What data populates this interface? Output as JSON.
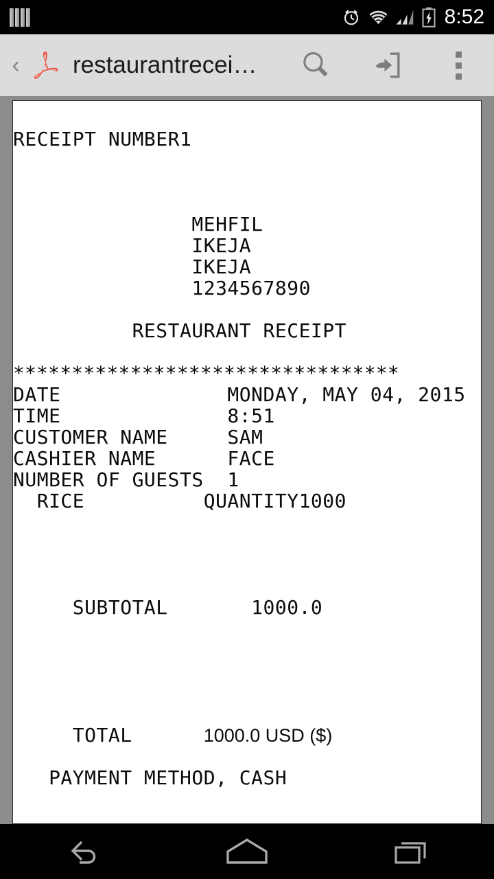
{
  "status_bar": {
    "time": "8:52",
    "icons": [
      "signal-bars-icon",
      "alarm-icon",
      "wifi-icon",
      "cell-signal-icon",
      "battery-charging-icon"
    ]
  },
  "app_bar": {
    "back_label": "‹",
    "app_logo": "adobe-acrobat-logo",
    "title": "restaurantrecei…",
    "search_icon": "search-icon",
    "open_with_icon": "open-with-icon",
    "overflow_icon": "overflow-menu-icon"
  },
  "receipt": {
    "receipt_number_line": "RECEIPT NUMBER1",
    "store_name": "MEHFIL",
    "store_city": "IKEJA",
    "store_area": "IKEJA",
    "store_phone": "1234567890",
    "doc_heading": "RESTAURANT RECEIPT",
    "divider": "*********************************",
    "fields": [
      {
        "label": "DATE",
        "value": "MONDAY, MAY 04, 2015"
      },
      {
        "label": "TIME",
        "value": "8:51"
      },
      {
        "label": "CUSTOMER NAME",
        "value": "SAM"
      },
      {
        "label": "CASHIER NAME",
        "value": "FACE"
      },
      {
        "label": "NUMBER OF GUESTS",
        "value": "1"
      }
    ],
    "line_item": {
      "name": "RICE",
      "quantity_label": "QUANTITY",
      "quantity": "1",
      "amount": "1000",
      "rendered": "  RICE          QUANTITY1000"
    },
    "subtotal_label": "SUBTOTAL",
    "subtotal_value": "1000.0",
    "total_label": "TOTAL",
    "total_value": "1000.0 USD ($)",
    "payment_line": "PAYMENT METHOD, CASH",
    "lines": {
      "l1": "RECEIPT NUMBER1",
      "l2": "               MEHFIL",
      "l3": "               IKEJA",
      "l4": "               IKEJA",
      "l5": "               1234567890",
      "l6": "          RESTAURANT RECEIPT",
      "l7": "*********************************",
      "l8": "DATE              MONDAY, MAY 04, 2015",
      "l9": "TIME              8:51",
      "l10": "CUSTOMER NAME     SAM",
      "l11": "CASHIER NAME      FACE",
      "l12": "NUMBER OF GUESTS  1",
      "l13": "  RICE          QUANTITY1000",
      "l14": "     SUBTOTAL       1000.0",
      "l15": "     TOTAL      ",
      "l16": "   PAYMENT METHOD, CASH"
    }
  },
  "nav_bar": {
    "back": "back-icon",
    "home": "home-icon",
    "recents": "recents-icon"
  },
  "colors": {
    "app_bar_bg": "#dcdcdc",
    "viewport_bg": "#8c8c8c",
    "page_bg": "#ffffff",
    "system_bg": "#000000",
    "pdf_red": "#f05b4a",
    "icon_gray": "#7d7d7d"
  }
}
